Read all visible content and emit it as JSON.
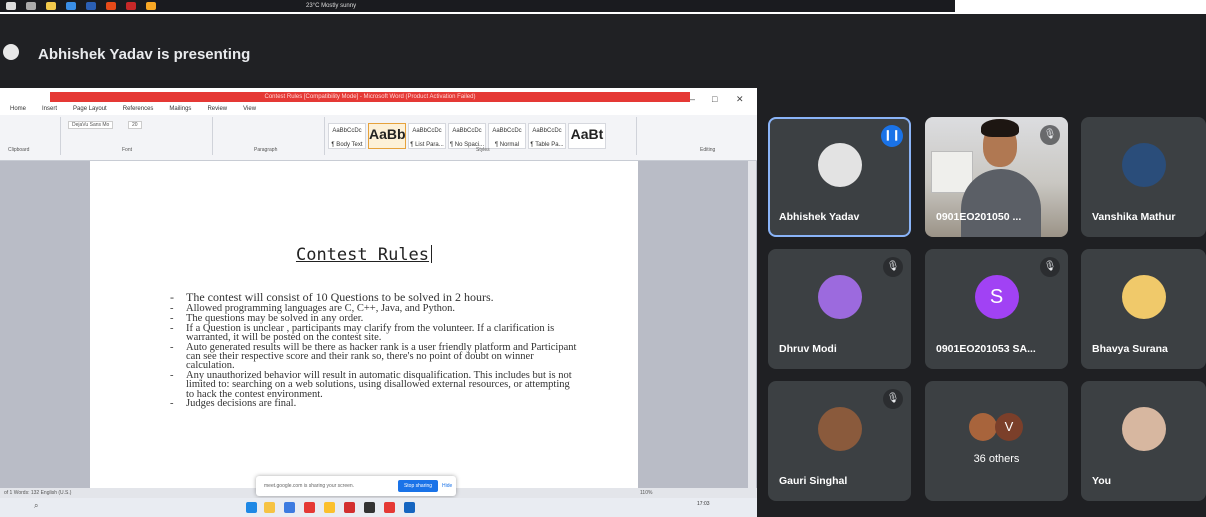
{
  "os_topbar": {
    "weather": "23°C Mostly sunny"
  },
  "meet": {
    "presenting_text": "Abhishek Yadav is presenting"
  },
  "word": {
    "title_bar": "Contest Rules [Compatibility Mode] - Microsoft Word (Product Activation Failed)",
    "tabs": [
      "Home",
      "Insert",
      "Page Layout",
      "References",
      "Mailings",
      "Review",
      "View"
    ],
    "font_name": "DejaVu Sans Mo",
    "font_size": "20",
    "styles": [
      {
        "sample": "AaBbCcDc",
        "name": "¶ Body Text"
      },
      {
        "sample": "AaBb",
        "name": "¶ Heading 1"
      },
      {
        "sample": "AaBbCcDc",
        "name": "¶ List Para..."
      },
      {
        "sample": "AaBbCcDc",
        "name": "¶ No Spaci..."
      },
      {
        "sample": "AaBbCcDc",
        "name": "¶ Normal"
      },
      {
        "sample": "AaBbCcDc",
        "name": "¶ Table Pa..."
      },
      {
        "sample": "AaBt",
        "name": "¶ Title"
      }
    ],
    "group_labels": {
      "clipboard": "Clipboard",
      "font": "Font",
      "paragraph": "Paragraph",
      "styles": "Styles",
      "editing": "Editing"
    },
    "doc_title": "Contest Rules",
    "rules": [
      "The contest will consist of 10 Questions to be solved in 2 hours.",
      "Allowed programming languages are C, C++, Java, and Python.",
      "The questions may be solved in any order.",
      "If a Question is unclear , participants may clarify from the volunteer. If a clarification is warranted, it will be posted on the contest site.",
      "Auto generated results will be there as hacker rank is a user friendly platform and Participant can see their respective score and their rank so, there's no point of doubt on winner calculation.",
      "Any unauthorized behavior will result in automatic disqualification. This includes but is not limited to: searching on a web solutions, using disallowed external resources, or attempting to hack the contest environment.",
      "Judges decisions are final."
    ],
    "status_text": "of 1   Words: 132   English (U.S.)",
    "zoom": "110%"
  },
  "share_bar": {
    "text": "meet.google.com is sharing your screen.",
    "stop_label": "Stop sharing",
    "hide_label": "Hide"
  },
  "taskbar": {
    "time": "17:03"
  },
  "participants": [
    {
      "name": "Abhishek Yadav"
    },
    {
      "name": "0901EO201050 ..."
    },
    {
      "name": "Vanshika Mathur"
    },
    {
      "name": "Dhruv Modi"
    },
    {
      "name": "0901EO201053 SA...",
      "initial": "S"
    },
    {
      "name": "Bhavya Surana"
    },
    {
      "name": "Gauri Singhal"
    },
    {
      "name": "",
      "count": "36 others",
      "initial": "V"
    },
    {
      "name": "You"
    }
  ]
}
